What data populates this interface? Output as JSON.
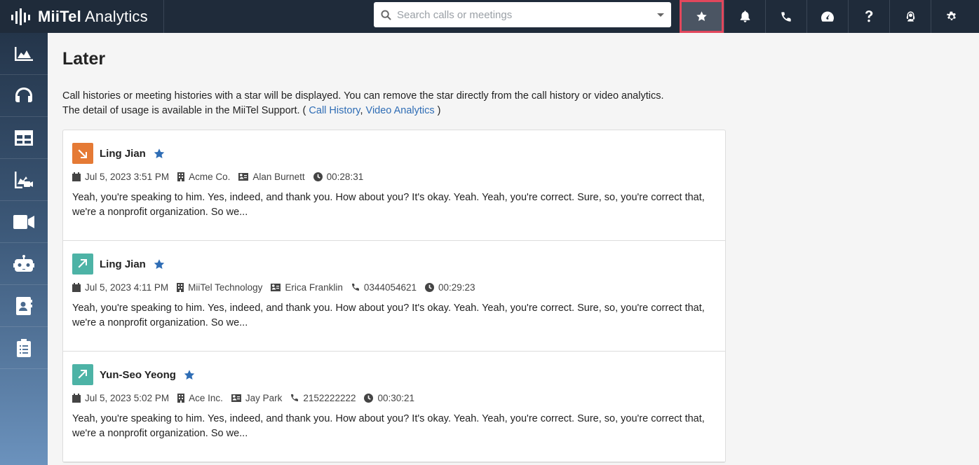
{
  "app": {
    "name_bold": "MiiTel",
    "name_rest": " Analytics"
  },
  "search": {
    "placeholder": "Search calls or meetings"
  },
  "topnav": [
    {
      "icon": "star-icon",
      "active": true
    },
    {
      "icon": "bell-icon"
    },
    {
      "icon": "phone-icon"
    },
    {
      "icon": "dashboard-gauge-icon"
    },
    {
      "icon": "help-icon"
    },
    {
      "icon": "user-support-icon"
    },
    {
      "icon": "gear-icon"
    }
  ],
  "sidebar": [
    {
      "icon": "area-chart-icon"
    },
    {
      "icon": "headset-icon"
    },
    {
      "icon": "table-icon"
    },
    {
      "icon": "chart-video-icon"
    },
    {
      "icon": "video-camera-icon"
    },
    {
      "icon": "robot-icon"
    },
    {
      "icon": "contact-book-icon"
    },
    {
      "icon": "clipboard-list-icon"
    }
  ],
  "page": {
    "title": "Later",
    "desc_line1": "Call histories or meeting histories with a star will be displayed. You can remove the star directly from the call history or video analytics.",
    "desc_line2_prefix": "The detail of usage is available in the MiiTel Support. ( ",
    "link_call_history": "Call History",
    "link_sep": ", ",
    "link_video_analytics": "Video Analytics",
    "desc_line2_suffix": " )"
  },
  "items": [
    {
      "direction": "outgoing",
      "name": "Ling Jian",
      "date": "Jul 5, 2023 3:51 PM",
      "company": "Acme Co.",
      "contact": "Alan Burnett",
      "phone": "",
      "duration": "00:28:31",
      "snippet": "Yeah, you're speaking to him. Yes, indeed, and thank you. How about you? It's okay. Yeah. Yeah, you're correct. Sure, so, you're correct that, we're a nonprofit organization. So we..."
    },
    {
      "direction": "incoming",
      "name": "Ling Jian",
      "date": "Jul 5, 2023 4:11 PM",
      "company": "MiiTel Technology",
      "contact": "Erica Franklin",
      "phone": "0344054621",
      "duration": "00:29:23",
      "snippet": "Yeah, you're speaking to him. Yes, indeed, and thank you. How about you? It's okay. Yeah. Yeah, you're correct. Sure, so, you're correct that, we're a nonprofit organization. So we..."
    },
    {
      "direction": "incoming",
      "name": "Yun-Seo Yeong",
      "date": "Jul 5, 2023 5:02 PM",
      "company": "Ace Inc.",
      "contact": "Jay Park",
      "phone": "2152222222",
      "duration": "00:30:21",
      "snippet": "Yeah, you're speaking to him. Yes, indeed, and thank you. How about you? It's okay. Yeah. Yeah, you're correct. Sure, so, you're correct that, we're a nonprofit organization. So we..."
    }
  ],
  "colors": {
    "accent_link": "#2f6db5",
    "star": "#2f6db5",
    "outgoing": "#e57a35",
    "incoming": "#4db3a6",
    "active_outline": "#e2475c"
  }
}
